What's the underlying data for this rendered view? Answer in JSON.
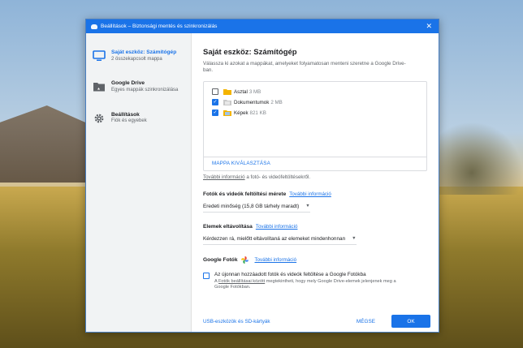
{
  "window": {
    "title": "Beállítások – Biztonsági mentés és szinkronizálás"
  },
  "sidebar": {
    "items": [
      {
        "title": "Saját eszköz: Számítógép",
        "subtitle": "2 összekapcsolt mappa",
        "icon": "monitor-icon"
      },
      {
        "title": "Google Drive",
        "subtitle": "Egyes mappák szinkronizálása",
        "icon": "drive-folder-icon"
      },
      {
        "title": "Beállítások",
        "subtitle": "Fiók és egyebek",
        "icon": "gear-icon"
      }
    ]
  },
  "main": {
    "heading": "Saját eszköz: Számítógép",
    "description": "Válassza ki azokat a mappákat, amelyeket folyamatosan menteni szeretne a Google Drive-ban.",
    "folders": [
      {
        "name": "Asztal",
        "size": "3 MB",
        "checked": false
      },
      {
        "name": "Dokumentumok",
        "size": "2 MB",
        "checked": true
      },
      {
        "name": "Képek",
        "size": "821 KB",
        "checked": true
      }
    ],
    "choose_folder": "MAPPA KIVÁLASZTÁSA",
    "more_info_link": "További információ",
    "more_info_suffix": " a fotó- és videófeltöltésekről.",
    "upload_size": {
      "title": "Fotók és videók feltöltési mérete",
      "link": "További információ",
      "selected": "Eredeti minőség (15,8 GB tárhely maradt)"
    },
    "removal": {
      "title": "Elemek eltávolítása",
      "link": "További információ",
      "selected": "Kérdezzen rá, mielőtt eltávolítaná az elemeket mindenhonnan"
    },
    "google_photos": {
      "title": "Google Fotók",
      "link": "További információ",
      "checkbox_label": "Az újonnan hozzáadott fotók és videók feltöltése a Google Fotókba",
      "note_prefix": "A ",
      "note_link": "Fotók beállításai között",
      "note_suffix": " megtekintheti, hogy mely Google Drive-elemek jelenjenek meg a Google Fotókban.",
      "checked": false
    },
    "usb_link": "USB-eszközök és SD-kártyák",
    "cancel_label": "MÉGSE",
    "ok_label": "OK"
  },
  "colors": {
    "accent": "#1a73e8"
  }
}
